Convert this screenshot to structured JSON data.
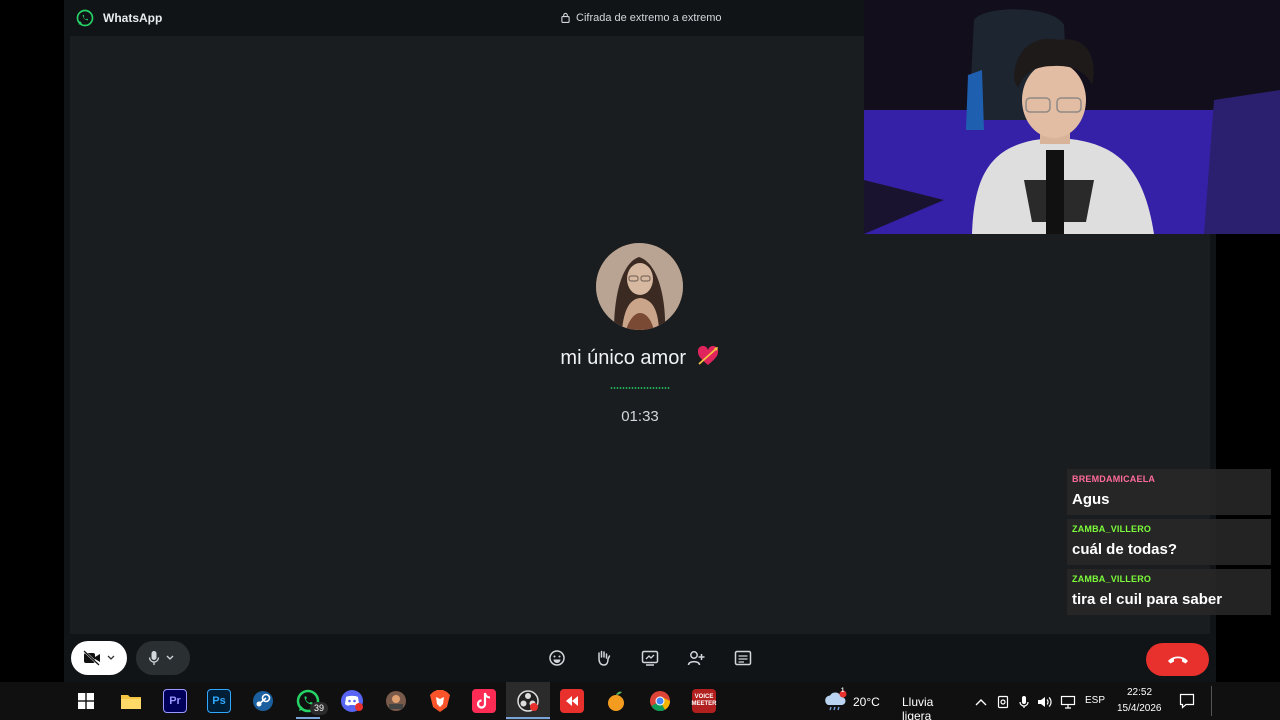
{
  "window": {
    "app_name": "WhatsApp",
    "encryption_text": "Cifrada de extremo a extremo"
  },
  "call": {
    "contact_name": "mi único amor ❤️‍🩹",
    "contact_name_text": "mi único amor",
    "timer": "01:33"
  },
  "controls": {
    "camera_icon": "video-off-icon",
    "mic_icon": "microphone-icon",
    "actions": [
      "emoji-icon",
      "raise-hand-icon",
      "screen-share-icon",
      "add-participant-icon",
      "chat-panel-icon"
    ],
    "end_call_icon": "phone-hangup-icon",
    "end_call_color": "#e8302c"
  },
  "stream_chat": [
    {
      "user": "BREMDAMICAELA",
      "message": "Agus",
      "color": "#ff6b9a"
    },
    {
      "user": "ZAMBA_VILLERO",
      "message": "cuál de todas?",
      "color": "#7cfc3a"
    },
    {
      "user": "ZAMBA_VILLERO",
      "message": "tira el cuil para saber",
      "color": "#7cfc3a"
    }
  ],
  "taskbar": {
    "apps": [
      "windows-start",
      "file-explorer",
      "premiere-pro",
      "photoshop",
      "steam",
      "whatsapp",
      "discord",
      "app-icon",
      "brave",
      "tiktok",
      "obs",
      "streaming-app",
      "fl-studio",
      "chrome",
      "voicemeeter"
    ],
    "whatsapp_badge": "39",
    "premiere_label": "Pr",
    "photoshop_label": "Ps",
    "voice_label": "VOICE",
    "meeter_label": "MEETER",
    "weather_temp": "20°C",
    "weather_desc": "Lluvia ligera",
    "weather_alert": "1",
    "language": "ESP",
    "time": "22:52",
    "date": "15/4/2026"
  }
}
